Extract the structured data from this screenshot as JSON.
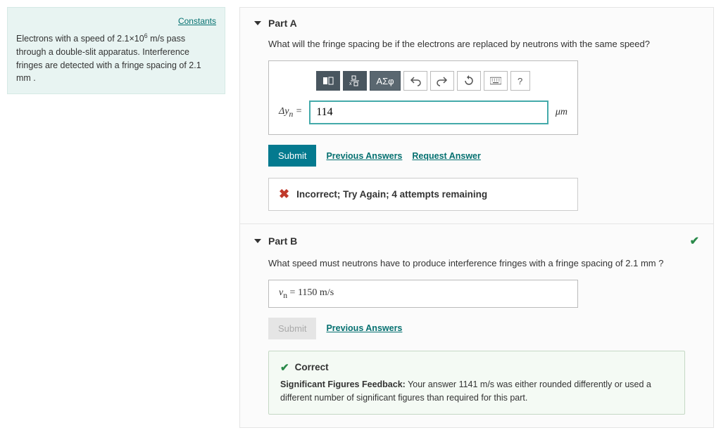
{
  "sidebar": {
    "constants_link": "Constants",
    "problem_html": "Electrons with a speed of 2.1×10<sup>6</sup>  m/s pass through a double-slit apparatus. Interference fringes are detected with a fringe spacing of 2.1  mm ."
  },
  "partA": {
    "title": "Part A",
    "question": "What will the fringe spacing be if the electrons are replaced by neutrons with the same speed?",
    "toolbar": {
      "symbols": "ΑΣφ",
      "help": "?"
    },
    "answer_label_html": "Δ<i>y</i><sub>n</sub> = ",
    "answer_value": "114",
    "unit_html": "<i>μ</i>m",
    "submit_label": "Submit",
    "prev_answers": "Previous Answers",
    "request_answer": "Request Answer",
    "feedback": "Incorrect; Try Again; 4 attempts remaining"
  },
  "partB": {
    "title": "Part B",
    "question": "What speed must neutrons have to produce interference fringes with a fringe spacing of 2.1  mm ?",
    "answer_display_html": "<i>v</i><sub>n</sub> =   1150   m/s",
    "submit_label": "Submit",
    "prev_answers": "Previous Answers",
    "correct_title": "Correct",
    "sig_fig_label": "Significant Figures Feedback:",
    "sig_fig_text_html": " Your answer 1141 m/s was either rounded differently or used a different number of significant figures than required for this part."
  }
}
